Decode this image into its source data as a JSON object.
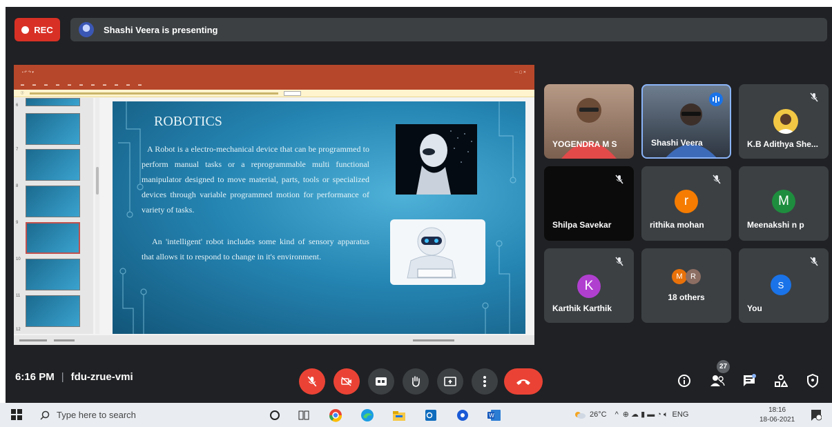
{
  "top": {
    "rec_label": "REC",
    "presenting": "Shashi Veera is presenting"
  },
  "slide": {
    "title": "ROBOTICS",
    "para1": "A Robot is a electro-mechanical device that can be programmed to perform manual tasks or a reprogrammable multi functional manipulator designed to move material, parts, tools or specialized devices through variable programmed motion for performance of variety of tasks.",
    "para2": "An 'intelligent' robot includes some kind of sensory apparatus that allows it to respond to change in it's environment."
  },
  "thumbnail_numbers": [
    "6",
    "7",
    "8",
    "9",
    "10",
    "11",
    "12"
  ],
  "participants": [
    {
      "name": "YOGENDRA M S",
      "muted": false
    },
    {
      "name": "Shashi Veera",
      "muted": false,
      "speaking": true
    },
    {
      "name": "K.B Adithya She...",
      "muted": true
    },
    {
      "name": "Shilpa Savekar",
      "muted": true
    },
    {
      "name": "rithika mohan",
      "muted": true,
      "initial": "r",
      "color": "#f57c00"
    },
    {
      "name": "Meenakshi n p",
      "muted": true,
      "initial": "M",
      "color": "#1e8e3e"
    },
    {
      "name": "Karthik Karthik",
      "muted": true,
      "initial": "K",
      "color": "#b03fd0"
    },
    {
      "name": "18 others",
      "initials": [
        "M",
        "R"
      ],
      "colors": [
        "#e8710a",
        "#8d6e63"
      ]
    },
    {
      "name": "You",
      "muted": true,
      "initial": "S",
      "color": "#1a73e8"
    }
  ],
  "meeting": {
    "time": "6:16 PM",
    "separator": "|",
    "code": "fdu-zrue-vmi",
    "participant_count": "27"
  },
  "taskbar": {
    "search_placeholder": "Type here to search",
    "weather": "26°C",
    "lang": "ENG",
    "time": "18:16",
    "date": "18-06-2021"
  },
  "colors": {
    "meet_bg": "#202124",
    "tile_bg": "#3c4043",
    "danger": "#ea4335",
    "ppt_ribbon": "#b7472a"
  }
}
